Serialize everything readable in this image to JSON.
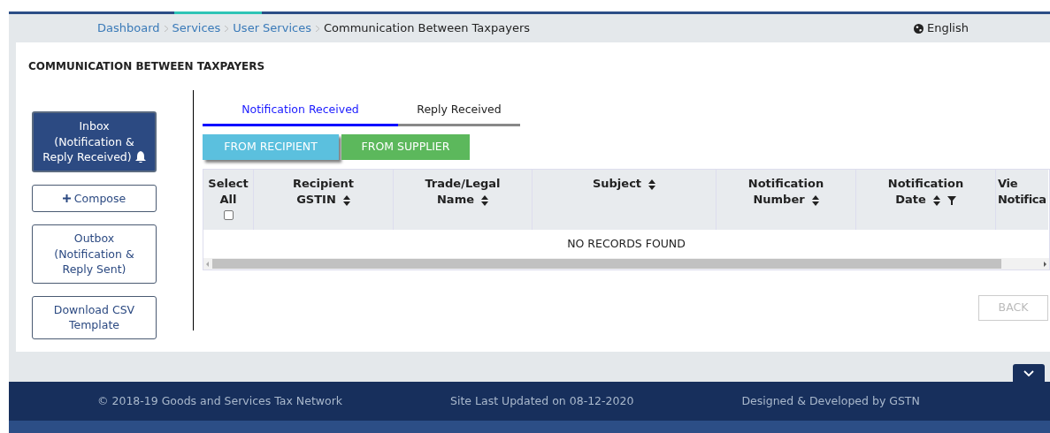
{
  "breadcrumbs": [
    {
      "label": "Dashboard",
      "link": true
    },
    {
      "label": "Services",
      "link": true
    },
    {
      "label": "User Services",
      "link": true
    },
    {
      "label": "Communication Between Taxpayers",
      "link": false
    }
  ],
  "language": "English",
  "page_title": "COMMUNICATION BETWEEN TAXPAYERS",
  "side_nav": [
    {
      "lines": [
        "Inbox",
        "(Notification &",
        "Reply Received)"
      ],
      "selected": true,
      "kind": "bell"
    },
    {
      "lines": [
        "Compose"
      ],
      "selected": false,
      "kind": "plus"
    },
    {
      "lines": [
        "Outbox",
        "(Notification &",
        "Reply Sent)"
      ],
      "selected": false,
      "kind": "plain"
    },
    {
      "lines": [
        "Download CSV",
        "Template"
      ],
      "selected": false,
      "kind": "plain"
    }
  ],
  "tabs": [
    {
      "label": "Notification Received",
      "selected": true
    },
    {
      "label": "Reply Received",
      "selected": false
    }
  ],
  "filters": [
    {
      "label": "FROM RECIPIENT",
      "selected": true,
      "color": "#5bc0de"
    },
    {
      "label": "FROM SUPPLIER",
      "selected": false,
      "color": "#5cb85c"
    }
  ],
  "table": {
    "columns": [
      {
        "lines": [
          "Select",
          "All"
        ],
        "kind": "checkbox",
        "checked": false
      },
      {
        "lines": [
          "Recipient",
          "GSTIN"
        ],
        "kind": "sort"
      },
      {
        "lines": [
          "Trade/Legal",
          "Name"
        ],
        "kind": "sort"
      },
      {
        "lines": [
          "Subject"
        ],
        "kind": "sort"
      },
      {
        "lines": [
          "Notification",
          "Number"
        ],
        "kind": "sort"
      },
      {
        "lines": [
          "Notification",
          "Date"
        ],
        "kind": "sort_filter"
      },
      {
        "lines": [
          "Vie",
          "Notifica"
        ],
        "kind": "cut"
      }
    ],
    "empty_message": "NO RECORDS FOUND"
  },
  "back_button": {
    "label": "BACK",
    "disabled": true
  },
  "footer": [
    "© 2018-19 Goods and Services Tax Network",
    "Site Last Updated on 08-12-2020",
    "Designed & Developed by GSTN"
  ]
}
